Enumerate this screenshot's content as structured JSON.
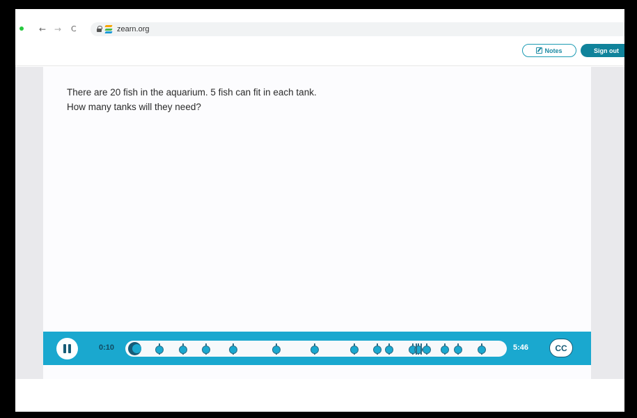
{
  "browser": {
    "url": "zearn.org",
    "back_icon": "arrow-left-icon",
    "forward_icon": "arrow-right-icon",
    "reload_icon": "reload-icon"
  },
  "header": {
    "notes_label": "Notes",
    "signout_label": "Sign out"
  },
  "problem": {
    "line1": "There are 20 fish in the aquarium. 5 fish can fit in each tank.",
    "line2": "How many tanks will they need?"
  },
  "player": {
    "current_time": "0:10",
    "total_time": "5:46",
    "cc_label": "CC",
    "progress_fraction": 0.03,
    "chapter_marker_count": 20
  },
  "colors": {
    "player_bar": "#1aa8cf",
    "accent_dark": "#175b76",
    "signout_bg": "#10839b"
  }
}
